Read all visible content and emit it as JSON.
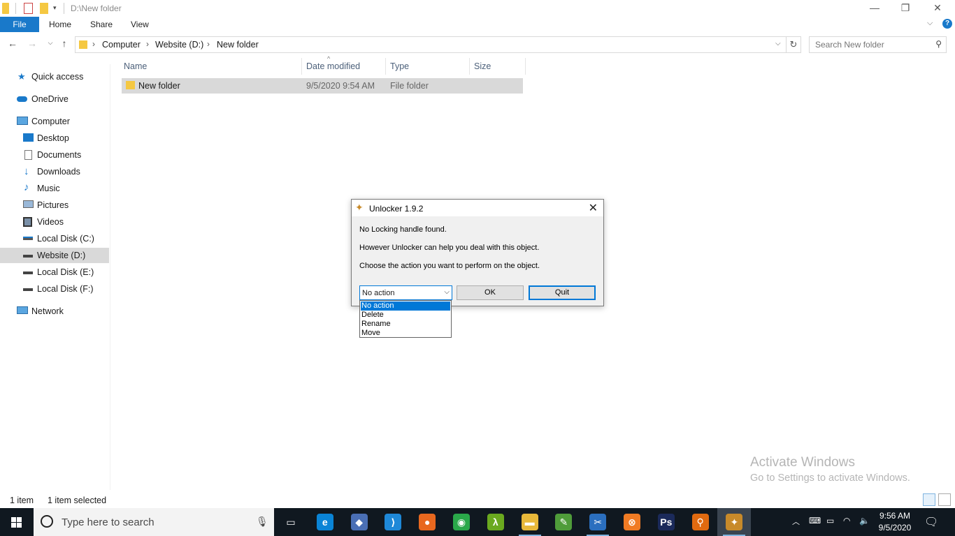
{
  "window": {
    "title": "D:\\New folder",
    "minimize": "—",
    "restore": "❐",
    "close": "✕"
  },
  "ribbon": {
    "tabs": [
      "File",
      "Home",
      "Share",
      "View"
    ],
    "expand": "⌵",
    "help": "?"
  },
  "address": {
    "crumbs": [
      "Computer",
      "Website (D:)",
      "New folder"
    ],
    "search_placeholder": "Search New folder"
  },
  "nav": {
    "quick_access": "Quick access",
    "onedrive": "OneDrive",
    "computer": "Computer",
    "children": [
      "Desktop",
      "Documents",
      "Downloads",
      "Music",
      "Pictures",
      "Videos",
      "Local Disk (C:)",
      "Website (D:)",
      "Local Disk (E:)",
      "Local Disk (F:)"
    ],
    "network": "Network",
    "selected": "Website (D:)"
  },
  "file_list": {
    "columns": [
      "Name",
      "Date modified",
      "Type",
      "Size"
    ],
    "rows": [
      {
        "name": "New folder",
        "date": "9/5/2020 9:54 AM",
        "type": "File folder",
        "size": ""
      }
    ]
  },
  "status": {
    "items": "1 item",
    "selected": "1 item selected"
  },
  "watermark": {
    "line1": "Activate Windows",
    "line2": "Go to Settings to activate Windows."
  },
  "dialog": {
    "title": "Unlocker 1.9.2",
    "line1": "No Locking handle found.",
    "line2": "However Unlocker can help you deal with this object.",
    "line3": "Choose the action you want to perform on the object.",
    "combo_value": "No action",
    "options": [
      "No action",
      "Delete",
      "Rename",
      "Move"
    ],
    "ok": "OK",
    "quit": "Quit"
  },
  "taskbar": {
    "search_placeholder": "Type here to search",
    "time": "9:56 AM",
    "date": "9/5/2020",
    "apps": [
      {
        "name": "task-view",
        "glyph": "▭",
        "color": "#101820"
      },
      {
        "name": "edge",
        "glyph": "e",
        "color": "#0a84d6"
      },
      {
        "name": "git",
        "glyph": "◆",
        "color": "#4a6fb5"
      },
      {
        "name": "vscode",
        "glyph": "⟩",
        "color": "#1e88d8"
      },
      {
        "name": "firefox",
        "glyph": "●",
        "color": "#e8681f"
      },
      {
        "name": "chrome",
        "glyph": "◉",
        "color": "#2aa84a"
      },
      {
        "name": "lambda",
        "glyph": "λ",
        "color": "#6aa91f"
      },
      {
        "name": "explorer",
        "glyph": "▬",
        "color": "#e8b83a"
      },
      {
        "name": "notepad",
        "glyph": "✎",
        "color": "#4f9c3a"
      },
      {
        "name": "snip",
        "glyph": "✂",
        "color": "#2b6fbf"
      },
      {
        "name": "xampp",
        "glyph": "⊗",
        "color": "#f07b24"
      },
      {
        "name": "photoshop",
        "glyph": "Ps",
        "color": "#1b2a5a"
      },
      {
        "name": "search-tool",
        "glyph": "⚲",
        "color": "#e06a10"
      },
      {
        "name": "unlocker",
        "glyph": "✦",
        "color": "#c88a2a"
      }
    ]
  }
}
